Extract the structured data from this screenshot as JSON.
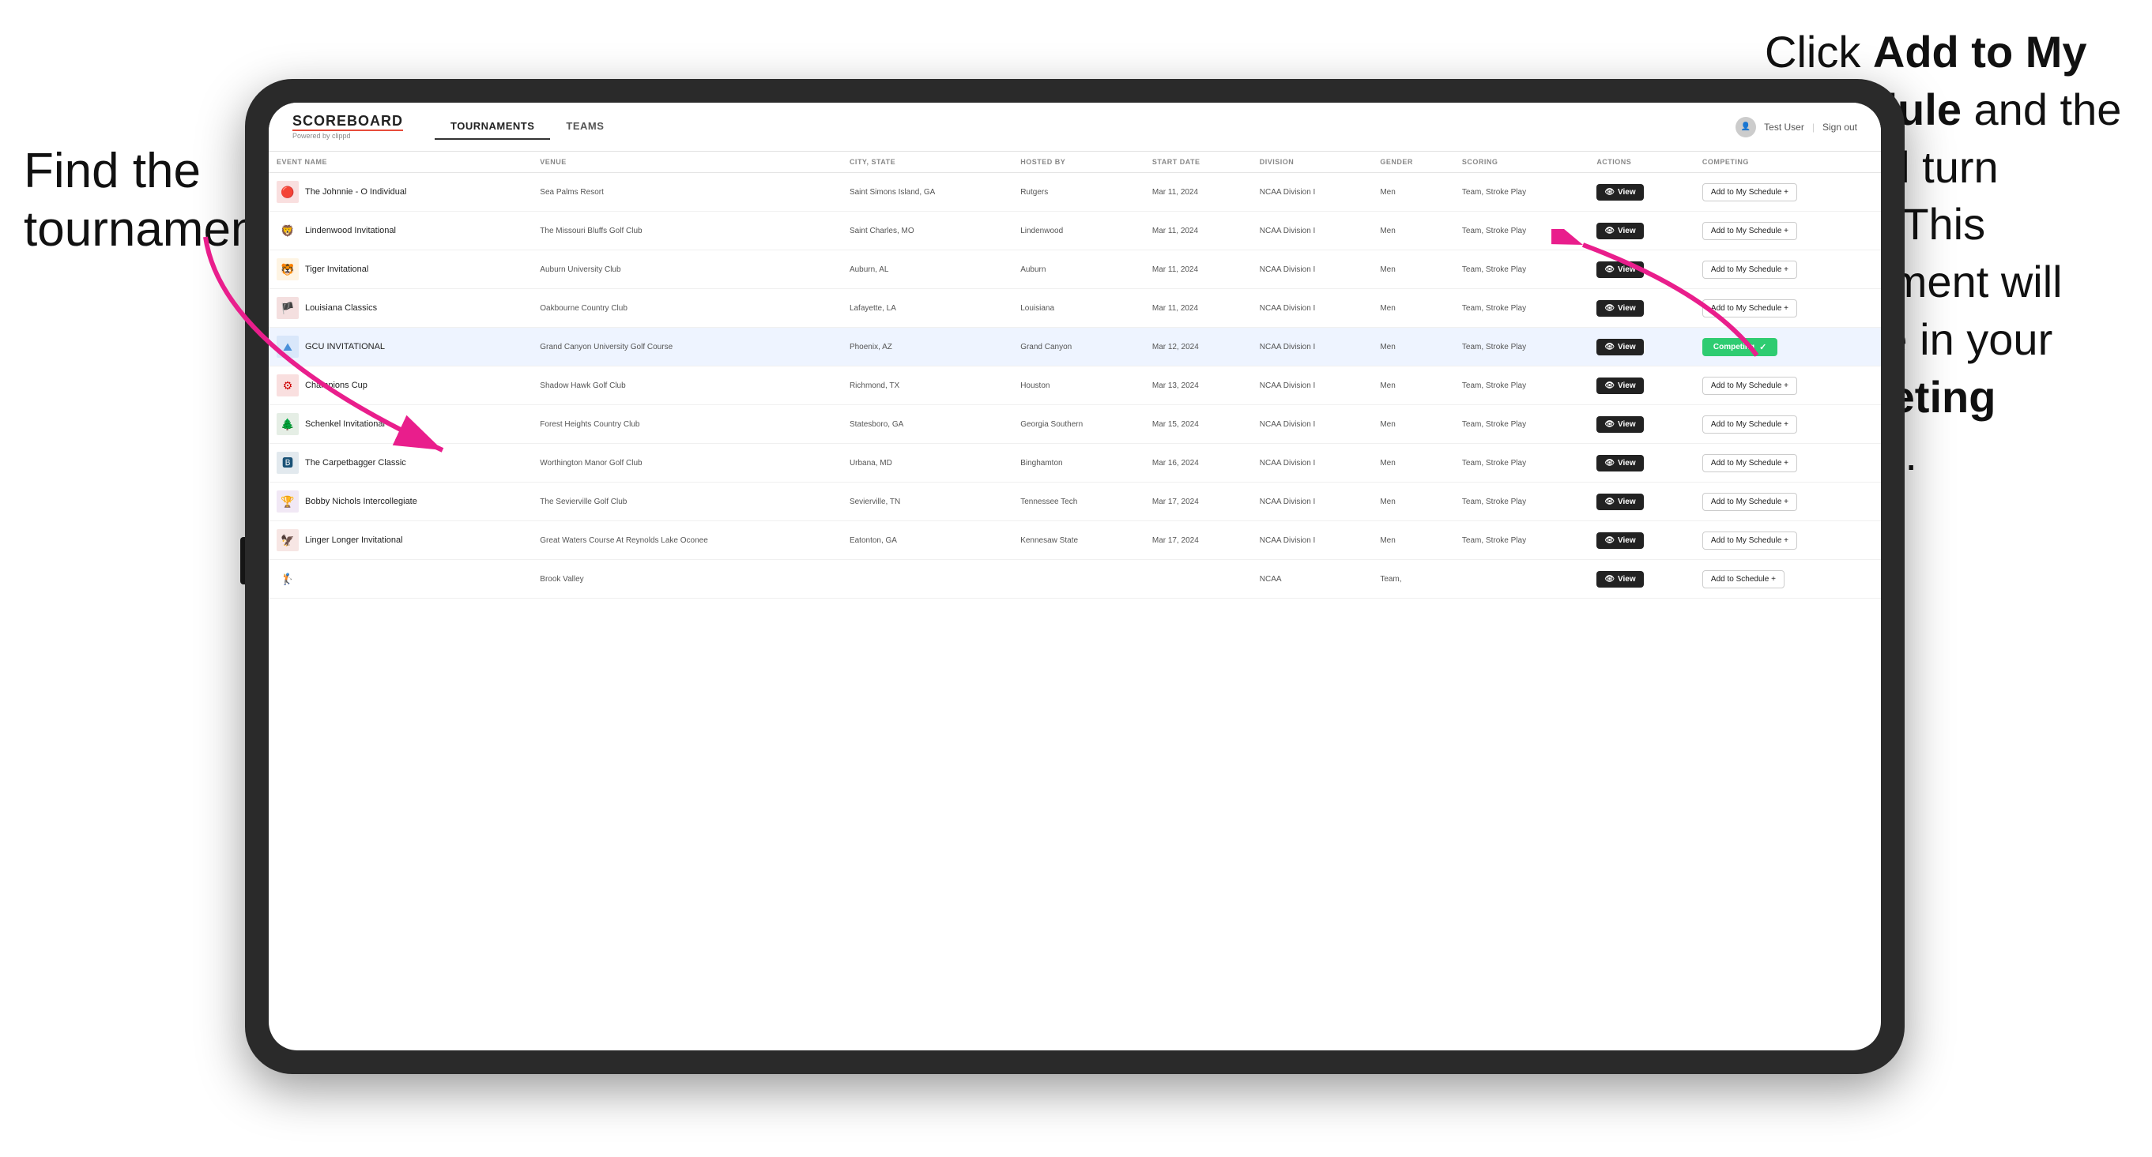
{
  "annotations": {
    "left": "Find the\ntournament.",
    "right_line1": "Click ",
    "right_bold1": "Add to My\nSchedule",
    "right_line2": " and the box will turn green. This tournament will now be in your ",
    "right_bold2": "Competing",
    "right_line3": " section."
  },
  "header": {
    "logo": "SCOREBOARD",
    "powered_by": "Powered by clippd",
    "nav_tabs": [
      "TOURNAMENTS",
      "TEAMS"
    ],
    "active_tab": "TOURNAMENTS",
    "user_label": "Test User",
    "sign_out": "Sign out"
  },
  "table": {
    "columns": [
      "EVENT NAME",
      "VENUE",
      "CITY, STATE",
      "HOSTED BY",
      "START DATE",
      "DIVISION",
      "GENDER",
      "SCORING",
      "ACTIONS",
      "COMPETING"
    ],
    "rows": [
      {
        "id": 1,
        "logo_emoji": "🔴",
        "logo_color": "#cc0000",
        "event_name": "The Johnnie - O Individual",
        "venue": "Sea Palms Resort",
        "city_state": "Saint Simons Island, GA",
        "hosted_by": "Rutgers",
        "start_date": "Mar 11, 2024",
        "division": "NCAA Division I",
        "gender": "Men",
        "scoring": "Team, Stroke Play",
        "action": "View",
        "competing_status": "add",
        "competing_label": "Add to My Schedule +",
        "highlighted": false
      },
      {
        "id": 2,
        "logo_emoji": "🦁",
        "logo_color": "#555",
        "event_name": "Lindenwood Invitational",
        "venue": "The Missouri Bluffs Golf Club",
        "city_state": "Saint Charles, MO",
        "hosted_by": "Lindenwood",
        "start_date": "Mar 11, 2024",
        "division": "NCAA Division I",
        "gender": "Men",
        "scoring": "Team, Stroke Play",
        "action": "View",
        "competing_status": "add",
        "competing_label": "Add to My Schedule +",
        "highlighted": false
      },
      {
        "id": 3,
        "logo_emoji": "🐯",
        "logo_color": "#f5a623",
        "event_name": "Tiger Invitational",
        "venue": "Auburn University Club",
        "city_state": "Auburn, AL",
        "hosted_by": "Auburn",
        "start_date": "Mar 11, 2024",
        "division": "NCAA Division I",
        "gender": "Men",
        "scoring": "Team, Stroke Play",
        "action": "View",
        "competing_status": "add",
        "competing_label": "Add to My Schedule +",
        "highlighted": false
      },
      {
        "id": 4,
        "logo_emoji": "🏴",
        "logo_color": "#aa0000",
        "event_name": "Louisiana Classics",
        "venue": "Oakbourne Country Club",
        "city_state": "Lafayette, LA",
        "hosted_by": "Louisiana",
        "start_date": "Mar 11, 2024",
        "division": "NCAA Division I",
        "gender": "Men",
        "scoring": "Team, Stroke Play",
        "action": "View",
        "competing_status": "add",
        "competing_label": "Add to My Schedule +",
        "highlighted": false
      },
      {
        "id": 5,
        "logo_emoji": "⛰",
        "logo_color": "#4a90d9",
        "event_name": "GCU INVITATIONAL",
        "venue": "Grand Canyon University Golf Course",
        "city_state": "Phoenix, AZ",
        "hosted_by": "Grand Canyon",
        "start_date": "Mar 12, 2024",
        "division": "NCAA Division I",
        "gender": "Men",
        "scoring": "Team, Stroke Play",
        "action": "View",
        "competing_status": "competing",
        "competing_label": "Competing ✓",
        "highlighted": true
      },
      {
        "id": 6,
        "logo_emoji": "⚙",
        "logo_color": "#cc0000",
        "event_name": "Champions Cup",
        "venue": "Shadow Hawk Golf Club",
        "city_state": "Richmond, TX",
        "hosted_by": "Houston",
        "start_date": "Mar 13, 2024",
        "division": "NCAA Division I",
        "gender": "Men",
        "scoring": "Team, Stroke Play",
        "action": "View",
        "competing_status": "add",
        "competing_label": "Add to My Schedule +",
        "highlighted": false
      },
      {
        "id": 7,
        "logo_emoji": "🌲",
        "logo_color": "#2c7a2c",
        "event_name": "Schenkel Invitational",
        "venue": "Forest Heights Country Club",
        "city_state": "Statesboro, GA",
        "hosted_by": "Georgia Southern",
        "start_date": "Mar 15, 2024",
        "division": "NCAA Division I",
        "gender": "Men",
        "scoring": "Team, Stroke Play",
        "action": "View",
        "competing_status": "add",
        "competing_label": "Add to My Schedule +",
        "highlighted": false
      },
      {
        "id": 8,
        "logo_emoji": "🅱",
        "logo_color": "#1a5276",
        "event_name": "The Carpetbagger Classic",
        "venue": "Worthington Manor Golf Club",
        "city_state": "Urbana, MD",
        "hosted_by": "Binghamton",
        "start_date": "Mar 16, 2024",
        "division": "NCAA Division I",
        "gender": "Men",
        "scoring": "Team, Stroke Play",
        "action": "View",
        "competing_status": "add",
        "competing_label": "Add to My Schedule +",
        "highlighted": false
      },
      {
        "id": 9,
        "logo_emoji": "🏆",
        "logo_color": "#8e44ad",
        "event_name": "Bobby Nichols Intercollegiate",
        "venue": "The Sevierville Golf Club",
        "city_state": "Sevierville, TN",
        "hosted_by": "Tennessee Tech",
        "start_date": "Mar 17, 2024",
        "division": "NCAA Division I",
        "gender": "Men",
        "scoring": "Team, Stroke Play",
        "action": "View",
        "competing_status": "add",
        "competing_label": "Add to My Schedule +",
        "highlighted": false
      },
      {
        "id": 10,
        "logo_emoji": "🦅",
        "logo_color": "#c0392b",
        "event_name": "Linger Longer Invitational",
        "venue": "Great Waters Course At Reynolds Lake Oconee",
        "city_state": "Eatonton, GA",
        "hosted_by": "Kennesaw State",
        "start_date": "Mar 17, 2024",
        "division": "NCAA Division I",
        "gender": "Men",
        "scoring": "Team, Stroke Play",
        "action": "View",
        "competing_status": "add",
        "competing_label": "Add to My Schedule +",
        "highlighted": false
      },
      {
        "id": 11,
        "logo_emoji": "🏌",
        "logo_color": "#555",
        "event_name": "",
        "venue": "Brook Valley",
        "city_state": "",
        "hosted_by": "",
        "start_date": "",
        "division": "NCAA",
        "gender": "Team,",
        "scoring": "",
        "action": "View",
        "competing_status": "add",
        "competing_label": "Add to Schedule +",
        "highlighted": false
      }
    ]
  }
}
